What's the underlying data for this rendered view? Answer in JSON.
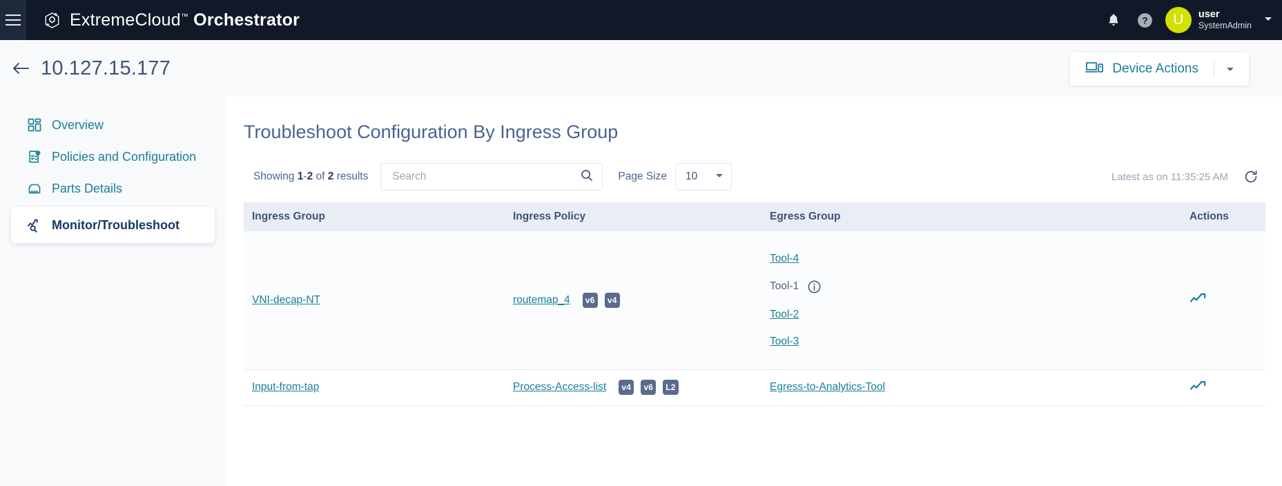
{
  "topbar": {
    "menu_icon": "hamburger-icon",
    "logo_icon": "extremecloud-logo-icon",
    "brand_name": "ExtremeCloud",
    "brand_tm": "™",
    "brand_product": "Orchestrator",
    "notifications_icon": "bell-icon",
    "help_icon": "help-circle-icon",
    "avatar_initial": "U",
    "avatar_color": "#d2e100",
    "user_name": "user",
    "user_role": "SystemAdmin",
    "caret_icon": "chevron-down-icon"
  },
  "pagehead": {
    "back_icon": "arrow-left-icon",
    "device_ip": "10.127.15.177",
    "device_actions_icon": "devices-icon",
    "device_actions_label": "Device Actions",
    "device_actions_caret": "chevron-down-icon"
  },
  "sidebar": {
    "items": [
      {
        "label": "Overview",
        "icon": "dashboard-grid-icon",
        "active": false
      },
      {
        "label": "Policies and Configuration",
        "icon": "document-gear-icon",
        "active": false
      },
      {
        "label": "Parts Details",
        "icon": "port-jack-icon",
        "active": false
      },
      {
        "label": "Monitor/Troubleshoot",
        "icon": "chart-search-icon",
        "active": true
      }
    ]
  },
  "main": {
    "title": "Troubleshoot Configuration By Ingress Group",
    "toolbar": {
      "showing_prefix": "Showing",
      "showing_from": "1",
      "showing_dash": "-",
      "showing_to": "2",
      "showing_of": "of",
      "showing_total": "2",
      "showing_suffix": "results",
      "search_placeholder": "Search",
      "search_value": "",
      "search_icon": "search-icon",
      "page_size_label": "Page Size",
      "page_size_value": "10",
      "page_size_caret": "chevron-down-icon",
      "latest_text": "Latest as on 11:35:25 AM",
      "refresh_icon": "refresh-icon"
    },
    "table": {
      "columns": [
        "Ingress Group",
        "Ingress Policy",
        "Egress Group",
        "Actions"
      ],
      "rows": [
        {
          "ingress_group": "VNI-decap-NT",
          "ingress_policy": "routemap_4",
          "policy_badges": [
            "v6",
            "v4"
          ],
          "egress": [
            {
              "label": "Tool-4",
              "link": true,
              "info": false
            },
            {
              "label": "Tool-1",
              "link": false,
              "info": true
            },
            {
              "label": "Tool-2",
              "link": true,
              "info": false
            },
            {
              "label": "Tool-3",
              "link": true,
              "info": false
            }
          ],
          "action_icon": "trending-up-icon"
        },
        {
          "ingress_group": "Input-from-tap",
          "ingress_policy": "Process-Access-list",
          "policy_badges": [
            "v4",
            "v6",
            "L2"
          ],
          "egress": [
            {
              "label": "Egress-to-Analytics-Tool",
              "link": true,
              "info": false
            }
          ],
          "action_icon": "trending-up-icon"
        }
      ]
    }
  },
  "colors": {
    "topbar_bg": "#111827",
    "accent_teal": "#1b7f96",
    "badge_bg": "#5b6b8c",
    "header_row_bg": "#e9edf4",
    "page_bg": "#f7f9fb"
  }
}
